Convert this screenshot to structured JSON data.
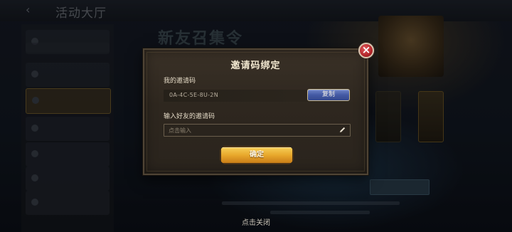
{
  "background": {
    "title": "活动大厅",
    "event_title": "新友召集令",
    "sidebar_items": [
      "",
      "",
      "",
      "",
      "",
      "",
      "",
      ""
    ]
  },
  "dialog": {
    "title": "邀请码绑定",
    "my_code_label": "我的邀请码",
    "my_code": "0A-4C-5E-8U-2N",
    "copy_label": "复制",
    "friend_code_label": "输入好友的邀请码",
    "input_placeholder": "点击输入",
    "input_value": "",
    "confirm_label": "确定",
    "close_icon": "close-icon"
  },
  "footer": {
    "tap_to_close": "点击关闭"
  },
  "colors": {
    "accent_gold": "#e8a82c",
    "copy_blue": "#4359a4",
    "close_red": "#b3272b",
    "panel_brown": "#2e271f"
  }
}
